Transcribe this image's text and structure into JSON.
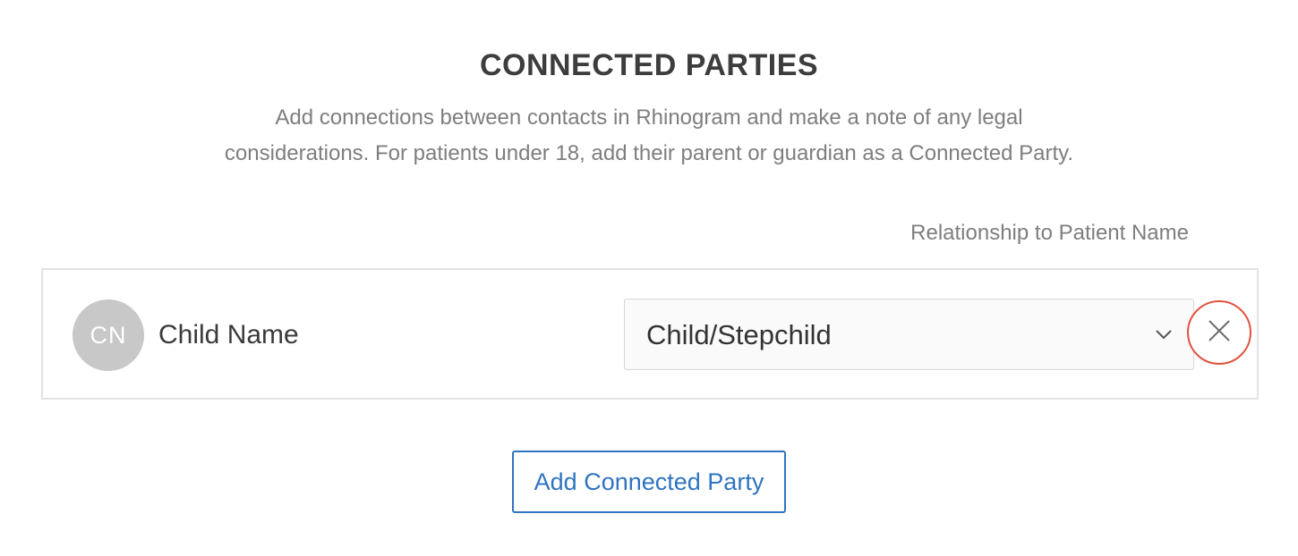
{
  "section": {
    "title": "CONNECTED PARTIES",
    "description_line1": "Add connections between contacts in Rhinogram and make a note of any legal",
    "description_line2": "considerations. For patients under 18, add their parent or guardian as a Connected Party."
  },
  "table": {
    "relationship_header": "Relationship to Patient Name"
  },
  "parties": [
    {
      "initials": "CN",
      "name": "Child Name",
      "relationship": "Child/Stepchild",
      "avatar_color": "#c8c8c8"
    }
  ],
  "actions": {
    "add_label": "Add Connected Party"
  },
  "icons": {
    "remove": "close-icon",
    "dropdown": "chevron-down-icon"
  },
  "colors": {
    "accent": "#2f74c0",
    "remove_highlight": "#e1533f"
  }
}
